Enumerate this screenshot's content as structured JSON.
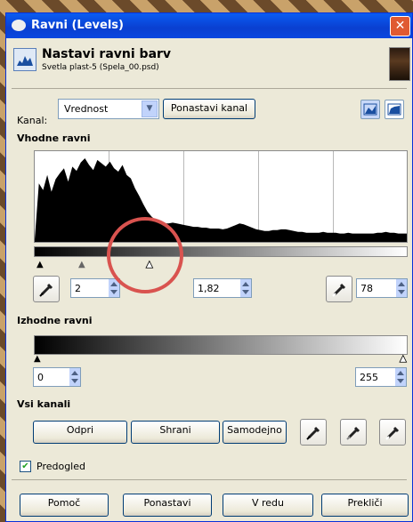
{
  "window": {
    "title": "Ravni (Levels)",
    "close_glyph": "✕"
  },
  "header": {
    "title": "Nastavi ravni barv",
    "subtitle": "Svetla plast-5 (Spela_00.psd)"
  },
  "channel": {
    "label": "Kanal:",
    "value": "Vrednost",
    "reset_label": "Ponastavi kanal"
  },
  "input_levels": {
    "label": "Vhodne ravni",
    "low": "2",
    "gamma": "1,82",
    "high": "78"
  },
  "output_levels": {
    "label": "Izhodne ravni",
    "low": "0",
    "high": "255"
  },
  "all_channels": {
    "label": "Vsi kanali",
    "open": "Odpri",
    "save": "Shrani",
    "auto": "Samodejno"
  },
  "preview": {
    "label": "Predogled",
    "checked": true
  },
  "footer": {
    "help": "Pomoč",
    "reset": "Ponastavi",
    "ok": "V redu",
    "cancel": "Prekliči"
  },
  "histogram": {
    "type": "area",
    "x_range": [
      0,
      255
    ],
    "values": [
      3,
      70,
      62,
      80,
      60,
      75,
      82,
      88,
      72,
      90,
      85,
      95,
      100,
      92,
      86,
      98,
      94,
      90,
      96,
      88,
      84,
      92,
      80,
      76,
      64,
      55,
      45,
      36,
      30,
      26,
      24,
      22,
      22,
      23,
      22,
      21,
      20,
      19,
      18,
      18,
      17,
      17,
      16,
      16,
      16,
      15,
      16,
      18,
      20,
      22,
      21,
      19,
      17,
      15,
      14,
      13,
      13,
      14,
      14,
      15,
      15,
      14,
      13,
      12,
      12,
      11,
      11,
      11,
      11,
      12,
      11,
      11,
      11,
      10,
      10,
      11,
      10,
      10,
      10,
      10,
      10,
      10,
      11,
      11,
      12,
      11,
      11,
      10,
      10,
      10
    ]
  },
  "icons": {
    "app": "gimp-icon",
    "header": "levels-icon",
    "picker": "eyedropper-icon"
  },
  "colors": {
    "title_bar": "#0a47e0",
    "annotation_circle": "#d9534f",
    "dialog_bg": "#ece9d8"
  }
}
